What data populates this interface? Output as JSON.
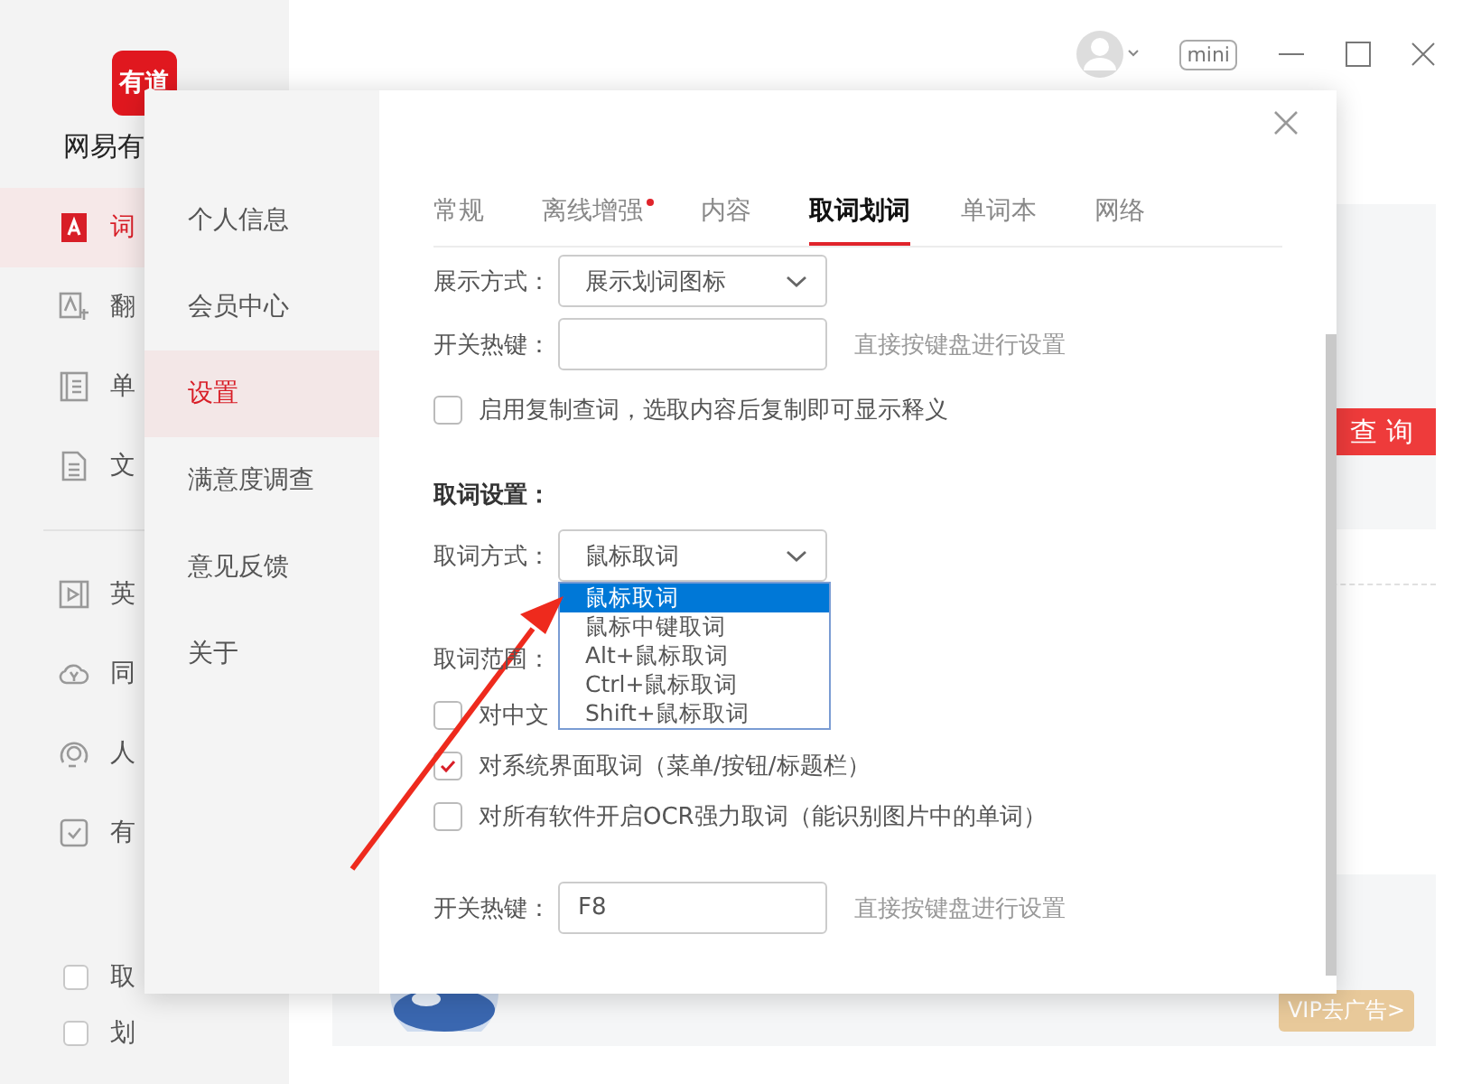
{
  "app": {
    "logo": "有道",
    "name": "网易有",
    "nav": [
      {
        "label": "词",
        "kind": "dict",
        "selected": true
      },
      {
        "label": "翻",
        "kind": "translate",
        "selected": false
      },
      {
        "label": "单",
        "kind": "book",
        "selected": false
      },
      {
        "label": "文",
        "kind": "doc",
        "selected": false
      }
    ],
    "nav_more": [
      {
        "label": "英",
        "kind": "video",
        "selected": false
      },
      {
        "label": "同",
        "kind": "cloud",
        "selected": false
      },
      {
        "label": "人",
        "kind": "person",
        "selected": false
      },
      {
        "label": "有",
        "kind": "task",
        "selected": false
      }
    ],
    "options": [
      {
        "label": "取",
        "checked": false
      },
      {
        "label": "划",
        "checked": false
      }
    ]
  },
  "topbar": {
    "mini": "mini"
  },
  "search_button": "查 询",
  "ad": {
    "vip": "VIP去广告>"
  },
  "dialog": {
    "menu": [
      {
        "label": "个人信息",
        "selected": false
      },
      {
        "label": "会员中心",
        "selected": false
      },
      {
        "label": "设置",
        "selected": true
      },
      {
        "label": "满意度调查",
        "selected": false
      },
      {
        "label": "意见反馈",
        "selected": false
      },
      {
        "label": "关于",
        "selected": false
      }
    ],
    "tabs": [
      {
        "label": "常规",
        "selected": false,
        "dot": false
      },
      {
        "label": "离线增强",
        "selected": false,
        "dot": true
      },
      {
        "label": "内容",
        "selected": false,
        "dot": false
      },
      {
        "label": "取词划词",
        "selected": true,
        "dot": false
      },
      {
        "label": "单词本",
        "selected": false,
        "dot": false
      },
      {
        "label": "网络",
        "selected": false,
        "dot": false
      }
    ],
    "display": {
      "label": "展示方式：",
      "value": "展示划词图标"
    },
    "hotkey_top": {
      "label": "开关热键：",
      "hint": "直接按键盘进行设置"
    },
    "copy_lookup": {
      "label": "启用复制查词，选取内容后复制即可显示释义",
      "checked": false
    },
    "section": "取词设置：",
    "mode": {
      "label": "取词方式：",
      "value": "鼠标取词",
      "options": [
        {
          "label": "鼠标取词",
          "selected": true
        },
        {
          "label": "鼠标中键取词",
          "selected": false
        },
        {
          "label": "Alt+鼠标取词",
          "selected": false
        },
        {
          "label": "Ctrl+鼠标取词",
          "selected": false
        },
        {
          "label": "Shift+鼠标取词",
          "selected": false
        }
      ]
    },
    "range": {
      "label": "取词范围：",
      "items": [
        {
          "label": "对中文",
          "checked": false
        },
        {
          "label": "对系统界面取词（菜单/按钮/标题栏）",
          "checked": true
        },
        {
          "label": "对所有软件开启OCR强力取词（能识别图片中的单词）",
          "checked": false
        }
      ]
    },
    "hotkey_bottom": {
      "label": "开关热键：",
      "value": "F8",
      "hint": "直接按键盘进行设置"
    }
  }
}
